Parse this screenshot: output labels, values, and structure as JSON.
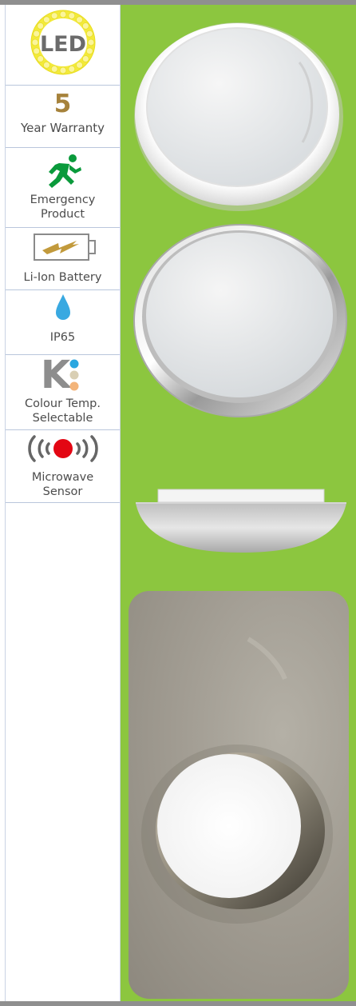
{
  "features": {
    "led": {
      "badge": "LED"
    },
    "warranty": {
      "years": "5",
      "label": "Year Warranty"
    },
    "emergency": {
      "line1": "Emergency",
      "line2": "Product"
    },
    "battery": {
      "label": "Li-Ion Battery"
    },
    "ip": {
      "label": "IP65"
    },
    "colour_temp": {
      "letter": "K",
      "line1": "Colour Temp.",
      "line2": "Selectable"
    },
    "microwave": {
      "line1": "Microwave",
      "line2": "Sensor"
    }
  },
  "colors": {
    "green_panel": "#8cc63f",
    "warranty_gold": "#a6823b",
    "emergency_green": "#0a9a3b",
    "ip_blue": "#39a9e1",
    "sensor_red": "#e30613",
    "led_yellow": "#f0e62a"
  },
  "icons": [
    "led-ring-icon",
    "running-man-icon",
    "battery-lightning-icon",
    "water-drop-icon",
    "k-temperature-dots-icon",
    "microwave-sensor-icon"
  ]
}
